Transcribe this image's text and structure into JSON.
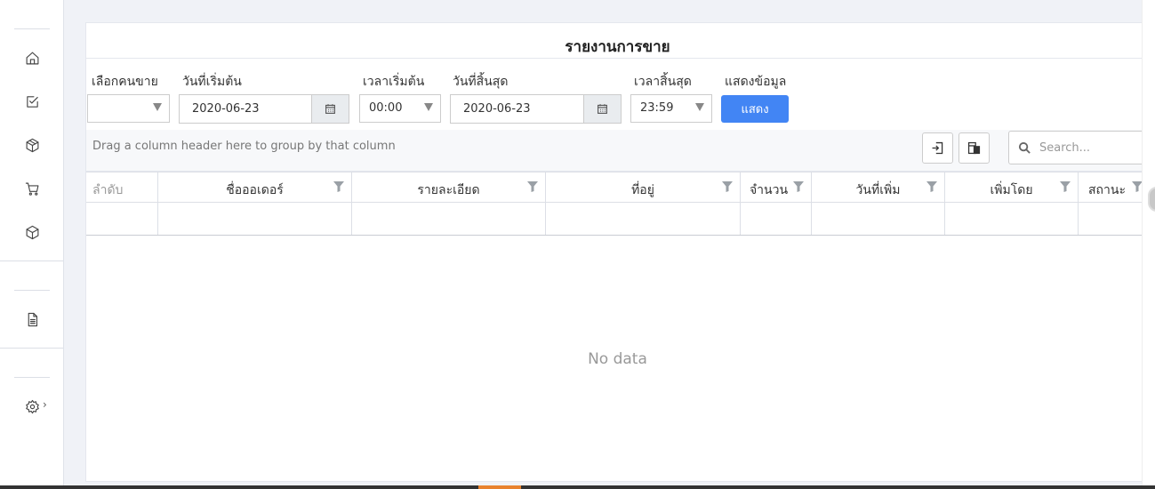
{
  "title": "รายงานการขาย",
  "filters": {
    "seller_label": "เลือกคนขาย",
    "seller_value": "",
    "start_date_label": "วันที่เริ่มต้น",
    "start_date_value": "2020-06-23",
    "start_time_label": "เวลาเริ่มต้น",
    "start_time_value": "00:00",
    "end_date_label": "วันที่สิ้นสุด",
    "end_date_value": "2020-06-23",
    "end_time_label": "เวลาสิ้นสุด",
    "end_time_value": "23:59",
    "show_label": "แสดงข้อมูล",
    "show_button": "แสดง"
  },
  "grid": {
    "group_panel_text": "Drag a column header here to group by that column",
    "search_placeholder": "Search...",
    "columns": [
      "ลำดับ",
      "ชื่อออเดอร์",
      "รายละเอียด",
      "ที่อยู่",
      "จำนวน",
      "วันที่เพิ่ม",
      "เพิ่มโดย",
      "สถานะ"
    ],
    "no_data": "No data"
  },
  "sidebar": {
    "icons": [
      "home-icon",
      "checklist-icon",
      "box-icon",
      "cart-icon",
      "package-icon",
      "document-icon",
      "settings-icon"
    ],
    "settings_chevron": "›"
  },
  "colors": {
    "accent": "#4285f4",
    "background": "#f0f2f7"
  }
}
